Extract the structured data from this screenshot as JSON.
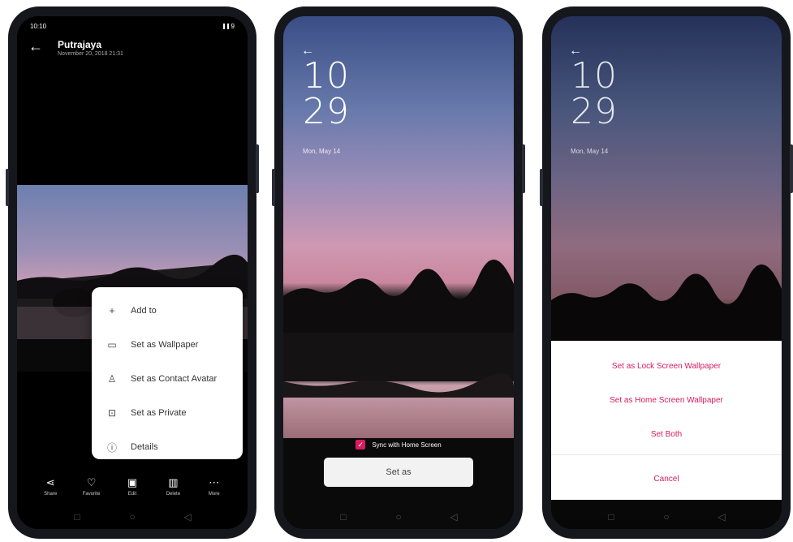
{
  "phone1": {
    "status": {
      "time": "10:10",
      "battery": "9"
    },
    "title": "Putrajaya",
    "subtitle": "November 20, 2018 21:31",
    "menu": [
      {
        "icon": "plus-icon",
        "glyph": "+",
        "label": "Add to"
      },
      {
        "icon": "wallpaper-icon",
        "glyph": "▭",
        "label": "Set as Wallpaper"
      },
      {
        "icon": "contact-icon",
        "glyph": "♙",
        "label": "Set as Contact Avatar"
      },
      {
        "icon": "lock-icon",
        "glyph": "⊡",
        "label": "Set as Private"
      },
      {
        "icon": "info-icon",
        "glyph": "ⓘ",
        "label": "Details"
      }
    ],
    "toolbar": [
      {
        "icon": "share-icon",
        "glyph": "⋖",
        "label": "Share"
      },
      {
        "icon": "heart-icon",
        "glyph": "♡",
        "label": "Favorite"
      },
      {
        "icon": "edit-icon",
        "glyph": "▣",
        "label": "Edit"
      },
      {
        "icon": "trash-icon",
        "glyph": "▥",
        "label": "Delete"
      },
      {
        "icon": "more-icon",
        "glyph": "⋯",
        "label": "More"
      }
    ]
  },
  "phone2": {
    "hour": "10",
    "minute": "29",
    "date": "Mon, May 14",
    "sync_label": "Sync with Home Screen",
    "set_as_label": "Set as"
  },
  "phone3": {
    "hour": "10",
    "minute": "29",
    "date": "Mon, May 14",
    "options": [
      "Set as Lock Screen Wallpaper",
      "Set as Home Screen Wallpaper",
      "Set Both"
    ],
    "cancel_label": "Cancel"
  },
  "colors": {
    "accent": "#d81b60",
    "phone_frame": "#15171c",
    "sky_top": "#6b7fb0",
    "sky_pink": "#e7a1b3"
  }
}
